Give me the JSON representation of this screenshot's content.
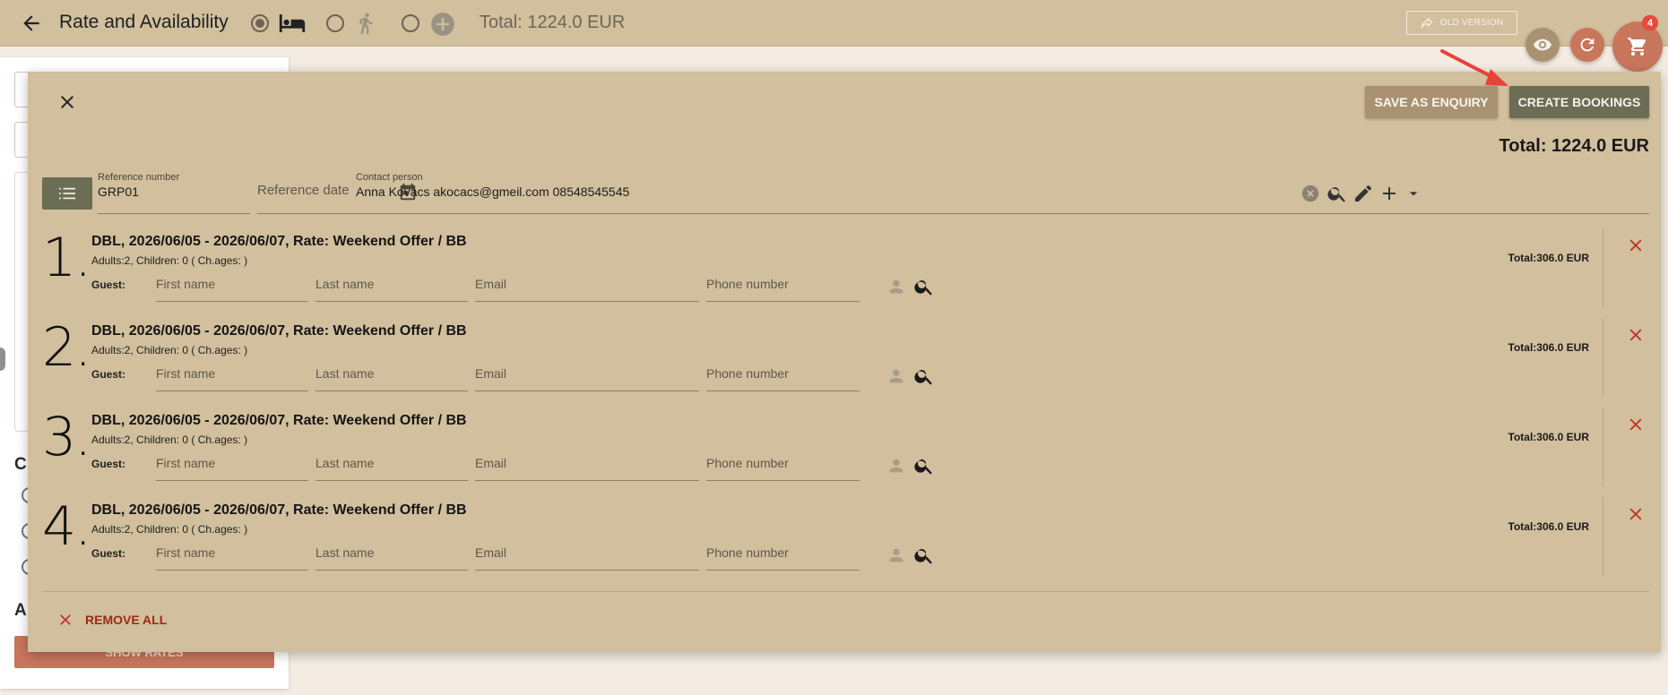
{
  "header": {
    "title": "Rate and Availability",
    "total": "Total: 1224.0 EUR",
    "old_version_label": "OLD VERSION",
    "cart_count": "4",
    "mode_icons": [
      "bed-icon",
      "walking-person-icon",
      "add-circle-icon"
    ]
  },
  "background": {
    "btn_label": "SHOW RATES",
    "heading_c": "C",
    "heading_a": "A"
  },
  "modal": {
    "save_enquiry_label": "SAVE AS ENQUIRY",
    "create_bookings_label": "CREATE BOOKINGS",
    "total": "Total: 1224.0 EUR",
    "reference_number_label": "Reference number",
    "reference_number_value": "GRP01",
    "reference_date_placeholder": "Reference date",
    "contact_person_label": "Contact person",
    "contact_person_value": "Anna Kovacs akocacs@gmeil.com 08548545545",
    "remove_all_label": "REMOVE ALL",
    "guest_label": "Guest:",
    "placeholders": {
      "first_name": "First name",
      "last_name": "Last name",
      "email": "Email",
      "phone": "Phone number"
    },
    "bookings": [
      {
        "num": "1.",
        "title": "DBL, 2026/06/05 - 2026/06/07, Rate: Weekend Offer / BB",
        "occupancy": "Adults:2, Children: 0 ( Ch.ages: )",
        "total": "Total:306.0 EUR"
      },
      {
        "num": "2.",
        "title": "DBL, 2026/06/05 - 2026/06/07, Rate: Weekend Offer / BB",
        "occupancy": "Adults:2, Children: 0 ( Ch.ages: )",
        "total": "Total:306.0 EUR"
      },
      {
        "num": "3.",
        "title": "DBL, 2026/06/05 - 2026/06/07, Rate: Weekend Offer / BB",
        "occupancy": "Adults:2, Children: 0 ( Ch.ages: )",
        "total": "Total:306.0 EUR"
      },
      {
        "num": "4.",
        "title": "DBL, 2026/06/05 - 2026/06/07, Rate: Weekend Offer / BB",
        "occupancy": "Adults:2, Children: 0 ( Ch.ages: )",
        "total": "Total:306.0 EUR"
      }
    ]
  },
  "colors": {
    "bar": "#d1bf9d",
    "primary_button": "#6b6d55",
    "secondary_button": "#a89272",
    "danger": "#c0301f",
    "accent_fab": "#c8765c"
  }
}
